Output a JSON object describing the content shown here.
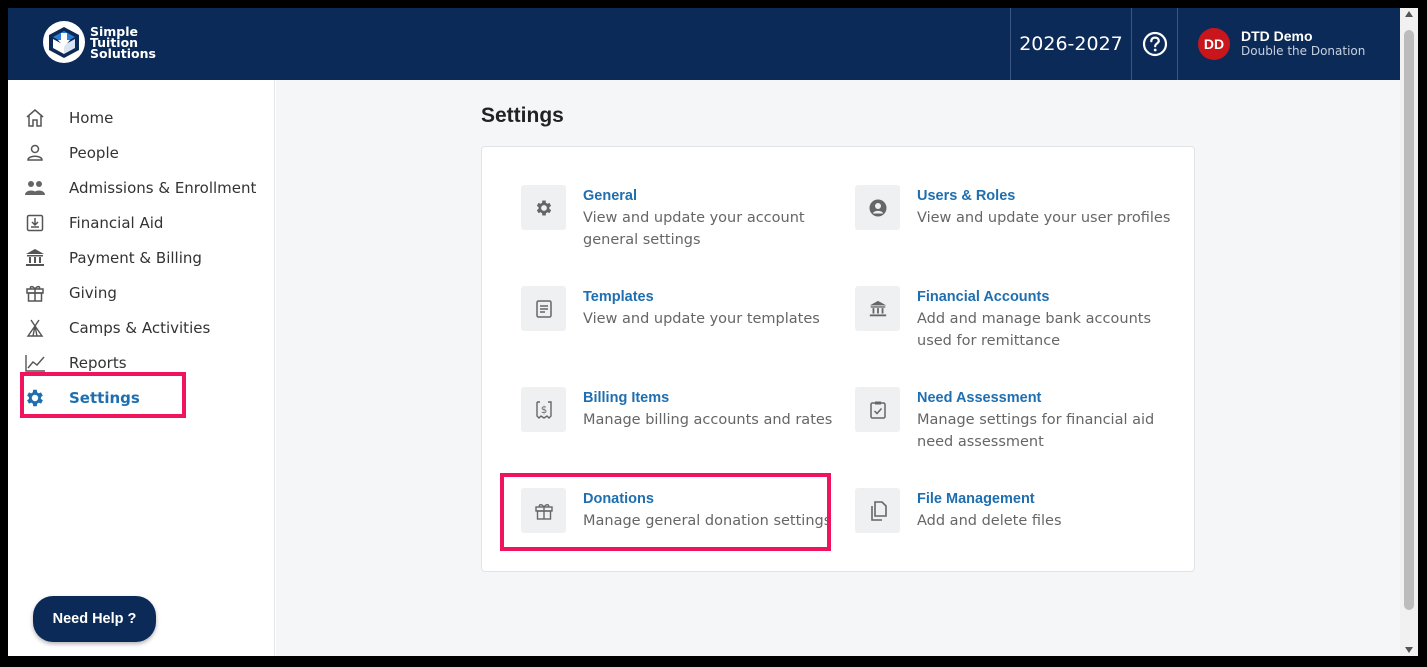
{
  "header": {
    "logo_lines": [
      "Simple",
      "Tuition",
      "Solutions"
    ],
    "school_year": "2026-2027",
    "help_icon": "question-circle-icon",
    "user": {
      "initials": "DD",
      "name": "DTD Demo",
      "organization": "Double the Donation",
      "avatar_color": "#c9161d"
    }
  },
  "sidebar": {
    "items": [
      {
        "label": "Home",
        "icon": "home-icon"
      },
      {
        "label": "People",
        "icon": "person-icon"
      },
      {
        "label": "Admissions & Enrollment",
        "icon": "people-group-icon"
      },
      {
        "label": "Financial Aid",
        "icon": "download-box-icon"
      },
      {
        "label": "Payment & Billing",
        "icon": "bank-icon"
      },
      {
        "label": "Giving",
        "icon": "gift-icon"
      },
      {
        "label": "Camps & Activities",
        "icon": "tent-icon"
      },
      {
        "label": "Reports",
        "icon": "line-chart-icon"
      },
      {
        "label": "Settings",
        "icon": "gear-icon",
        "active": true
      }
    ],
    "need_help": "Need Help ?"
  },
  "main": {
    "title": "Settings",
    "tiles": [
      {
        "title": "General",
        "description": "View and update your account general settings",
        "icon": "gear-icon"
      },
      {
        "title": "Users & Roles",
        "description": "View and update your user profiles",
        "icon": "user-circle-icon"
      },
      {
        "title": "Templates",
        "description": "View and update your templates",
        "icon": "document-icon"
      },
      {
        "title": "Financial Accounts",
        "description": "Add and manage bank accounts used for remittance",
        "icon": "bank-icon"
      },
      {
        "title": "Billing Items",
        "description": "Manage billing accounts and rates",
        "icon": "receipt-dollar-icon"
      },
      {
        "title": "Need Assessment",
        "description": "Manage settings for financial aid need assessment",
        "icon": "clipboard-check-icon"
      },
      {
        "title": "Donations",
        "description": "Manage general donation settings",
        "icon": "gift-icon"
      },
      {
        "title": "File Management",
        "description": "Add and delete files",
        "icon": "copy-files-icon"
      }
    ]
  },
  "colors": {
    "header_bg": "#0c2a57",
    "link": "#1f6fb0",
    "highlight": "#f0135e"
  }
}
